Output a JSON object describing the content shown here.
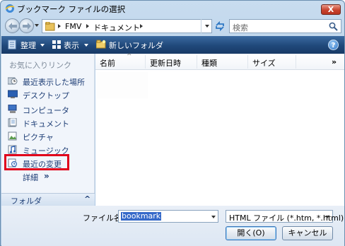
{
  "window": {
    "title": "ブックマーク ファイルの選択",
    "close": "X"
  },
  "address": {
    "segments": [
      "FMV",
      "ドキュメント"
    ],
    "search_placeholder": "検索"
  },
  "toolbar": {
    "organize": "整理",
    "views": "表示",
    "new_folder": "新しいフォルダ",
    "help": "?"
  },
  "favorites": {
    "title": "お気に入りリンク",
    "items": [
      {
        "label": "最近表示した場所",
        "icon": "recent-places-icon"
      },
      {
        "label": "デスクトップ",
        "icon": "desktop-icon"
      },
      {
        "label": "コンピュータ",
        "icon": "computer-icon"
      },
      {
        "label": "ドキュメント",
        "icon": "documents-icon"
      },
      {
        "label": "ピクチャ",
        "icon": "pictures-icon"
      },
      {
        "label": "ミュージック",
        "icon": "music-icon"
      },
      {
        "label": "最近の変更",
        "icon": "recently-changed-icon"
      }
    ],
    "more": "詳細",
    "more_arrows": "»",
    "folders": "フォルダ",
    "folders_arrow": "^"
  },
  "columns": {
    "name": "名前",
    "date": "更新日時",
    "type": "種類",
    "size": "サイズ",
    "more": "»",
    "sort_indicator": "^"
  },
  "bottom": {
    "filename_label": "ファイル名(N):",
    "filename_value": "bookmark",
    "filetype_value": "HTML ファイル (*.htm, *.html)",
    "open_label": "開く(O)",
    "cancel_label": "キャンセル"
  },
  "colors": {
    "toolbar": "#20487a",
    "highlight_box": "#e0001b",
    "link_text": "#1e3e76"
  }
}
